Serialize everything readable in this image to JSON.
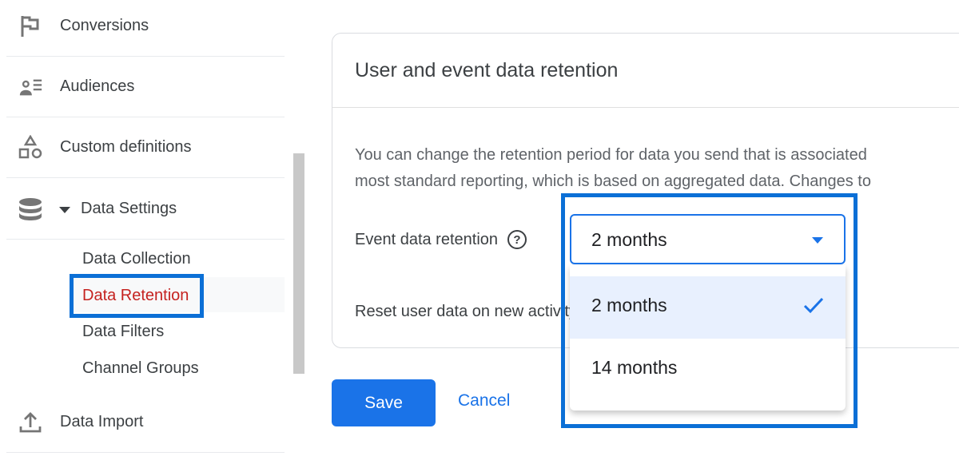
{
  "sidebar": {
    "items": [
      {
        "label": "Conversions",
        "icon": "flag-icon"
      },
      {
        "label": "Audiences",
        "icon": "audience-list-icon"
      },
      {
        "label": "Custom definitions",
        "icon": "shapes-icon"
      },
      {
        "label": "Data Settings",
        "icon": "database-icon",
        "expanded": true
      },
      {
        "label": "Data Import",
        "icon": "upload-icon"
      }
    ],
    "sub_items": [
      {
        "label": "Data Collection",
        "active": false
      },
      {
        "label": "Data Retention",
        "active": true
      },
      {
        "label": "Data Filters",
        "active": false
      },
      {
        "label": "Channel Groups",
        "active": false
      }
    ]
  },
  "card": {
    "title": "User and event data retention",
    "description_line1": "You can change the retention period for data you send that is associated",
    "description_line2": "most standard reporting, which is based on aggregated data. Changes to",
    "event_retention_label": "Event data retention",
    "help_icon": "help-circle-icon",
    "reset_label": "Reset user data on new activity"
  },
  "retention_select": {
    "value": "2 months",
    "options": [
      {
        "label": "2 months",
        "selected": true
      },
      {
        "label": "14 months",
        "selected": false
      }
    ]
  },
  "actions": {
    "save_label": "Save",
    "cancel_label": "Cancel"
  },
  "colors": {
    "accent": "#1a73e8",
    "active_nav": "#c5221f",
    "highlight_box": "#0b6fd6",
    "selected_option_bg": "#e8f0fe"
  }
}
